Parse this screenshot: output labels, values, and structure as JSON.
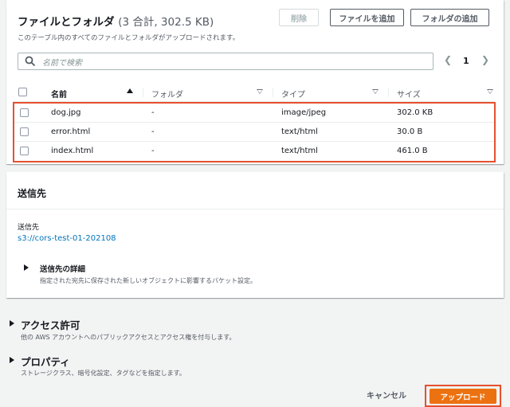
{
  "files": {
    "title": "ファイルとフォルダ",
    "count_text": "(3 合計, 302.5 KB)",
    "description": "このテーブル内のすべてのファイルとフォルダがアップロードされます。",
    "delete_label": "削除",
    "add_files_label": "ファイルを追加",
    "add_folder_label": "フォルダの追加",
    "search_placeholder": "名前で検索",
    "page_number": "1",
    "columns": {
      "name": "名前",
      "folder": "フォルダ",
      "type": "タイプ",
      "size": "サイズ"
    },
    "rows": [
      {
        "name": "dog.jpg",
        "folder": "-",
        "type": "image/jpeg",
        "size": "302.0 KB"
      },
      {
        "name": "error.html",
        "folder": "-",
        "type": "text/html",
        "size": "30.0 B"
      },
      {
        "name": "index.html",
        "folder": "-",
        "type": "text/html",
        "size": "461.0 B"
      }
    ]
  },
  "destination": {
    "title": "送信先",
    "label": "送信先",
    "link": "s3://cors-test-01-202108",
    "details_title": "送信先の詳細",
    "details_desc": "指定された宛先に保存された新しいオブジェクトに影響するバケット設定。"
  },
  "access": {
    "title": "アクセス許可",
    "desc": "他の AWS アカウントへのパブリックアクセスとアクセス権を付与します。"
  },
  "properties": {
    "title": "プロパティ",
    "desc": "ストレージクラス、暗号化設定、タグなどを指定します。"
  },
  "footer": {
    "cancel_label": "キャンセル",
    "upload_label": "アップロード"
  },
  "colors": {
    "highlight": "#e5502e",
    "primary_button": "#ec7211",
    "link": "#0073bb"
  }
}
